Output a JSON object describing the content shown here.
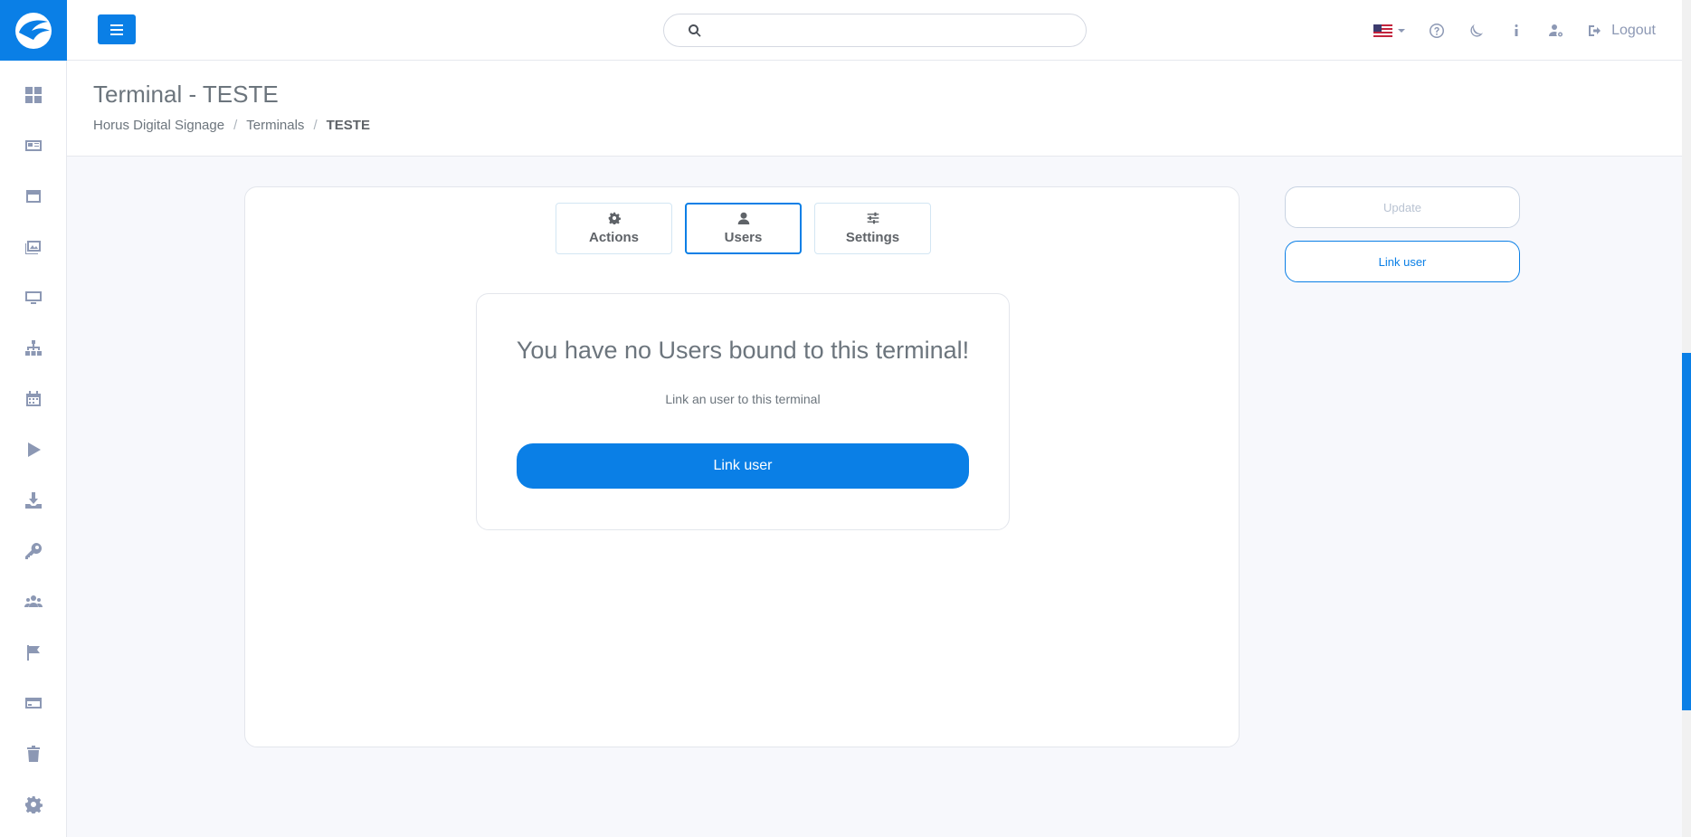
{
  "sidebar": {
    "logo": "horus-logo",
    "items": [
      {
        "name": "dashboard-icon"
      },
      {
        "name": "id-card-icon"
      },
      {
        "name": "window-icon"
      },
      {
        "name": "images-icon"
      },
      {
        "name": "monitor-icon"
      },
      {
        "name": "sitemap-icon"
      },
      {
        "name": "calendar-icon"
      },
      {
        "name": "play-icon"
      },
      {
        "name": "download-icon"
      },
      {
        "name": "key-icon"
      },
      {
        "name": "users-icon"
      },
      {
        "name": "flag-icon"
      },
      {
        "name": "card-icon"
      },
      {
        "name": "trash-icon"
      },
      {
        "name": "gear-icon"
      }
    ]
  },
  "topbar": {
    "search_placeholder": "",
    "language": "us-flag",
    "logout_label": "Logout"
  },
  "header": {
    "title": "Terminal - TESTE",
    "breadcrumb": [
      "Horus Digital Signage",
      "Terminals",
      "TESTE"
    ]
  },
  "tabs": [
    {
      "label": "Actions",
      "icon": "gear-icon"
    },
    {
      "label": "Users",
      "icon": "user-icon",
      "active": true
    },
    {
      "label": "Settings",
      "icon": "sliders-icon"
    }
  ],
  "empty_state": {
    "title": "You have no Users bound to this terminal!",
    "subtitle": "Link an user to this terminal",
    "button_label": "Link user"
  },
  "side_actions": {
    "update_label": "Update",
    "link_user_label": "Link user"
  },
  "colors": {
    "primary": "#0a7fe6",
    "sidebar_icon": "#8c98b4"
  }
}
